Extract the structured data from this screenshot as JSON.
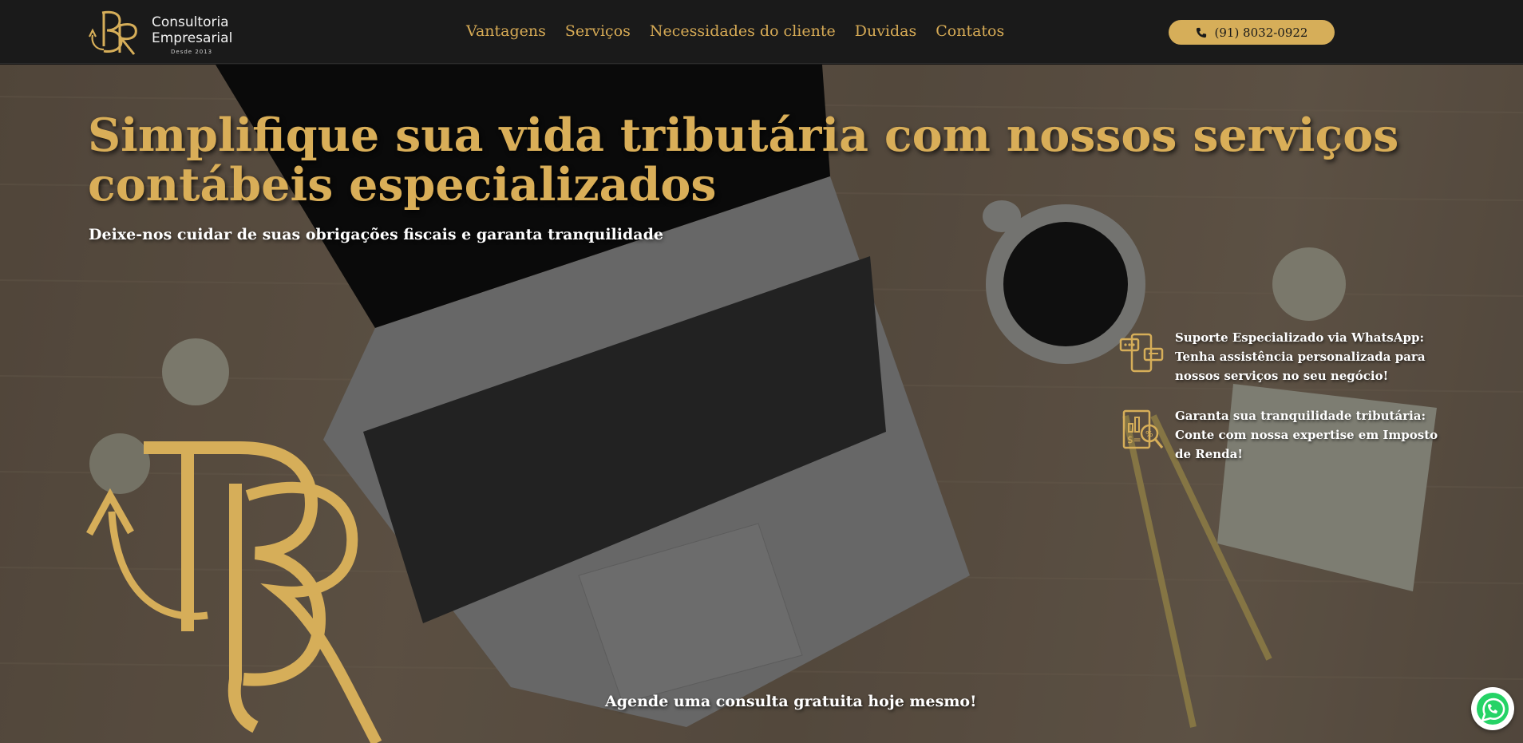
{
  "brand": {
    "line1": "Consultoria",
    "line2": "Empresarial",
    "since": "Desde 2013",
    "logo_icon": "br-monogram-icon"
  },
  "nav": {
    "items": [
      {
        "label": "Vantagens"
      },
      {
        "label": "Serviços"
      },
      {
        "label": "Necessidades do cliente"
      },
      {
        "label": "Duvidas"
      },
      {
        "label": "Contatos"
      }
    ],
    "phone": "(91) 8032-0922",
    "phone_icon": "phone-icon"
  },
  "hero": {
    "title": "Simplifique sua vida tributária com nossos serviços contábeis especializados",
    "subtitle": "Deixe-nos cuidar de suas obrigações fiscais e garanta tranquilidade",
    "features": [
      {
        "icon": "chat-phone-icon",
        "text": "Suporte Especializado via WhatsApp: Tenha assistência personalizada para nossos serviços no seu negócio!"
      },
      {
        "icon": "tax-report-icon",
        "text": "Garanta sua tranquilidade tributária: Conte com nossa expertise em Imposto de Renda!"
      }
    ],
    "cta": "Agende uma consulta gratuita hoje mesmo!"
  },
  "floating": {
    "whatsapp_icon": "whatsapp-icon"
  },
  "colors": {
    "gold": "#d6ae59",
    "navbar": "#1a1a1a",
    "text_light": "#ffffff"
  }
}
